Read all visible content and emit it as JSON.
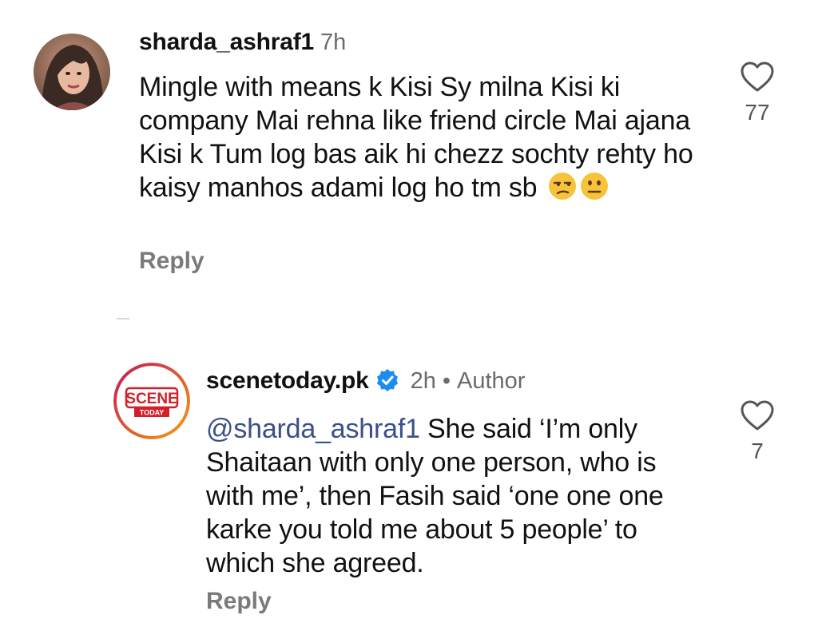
{
  "comments": [
    {
      "username": "sharda_ashraf1",
      "time": "7h",
      "text": "Mingle with means k Kisi Sy milna Kisi ki company Mai rehna like friend circle Mai ajana Kisi k Tum log bas aik hi chezz sochty rehty ho kaisy manhos adami log ho tm sb",
      "emojis": [
        "unamused-face-emoji",
        "neutral-face-emoji"
      ],
      "reply_label": "Reply",
      "like_count": "77",
      "icon": "heart-icon"
    },
    {
      "username": "scenetoday.pk",
      "time": "2h",
      "separator": "•",
      "author_badge": "Author",
      "mention": "@sharda_ashraf1",
      "text": " She said ‘I’m only Shaitaan with only one person, who is with me’, then Fasih said ‘one one one karke you told me about 5 people’ to which she agreed.",
      "reply_label": "Reply",
      "like_count": "7",
      "icon": "heart-icon",
      "avatar_logo": {
        "line1": "SCENE",
        "line2": "TODAY"
      }
    }
  ],
  "colors": {
    "mention": "#3a4f8c",
    "verified": "#1d8cf0",
    "muted": "#6b6b6b"
  }
}
